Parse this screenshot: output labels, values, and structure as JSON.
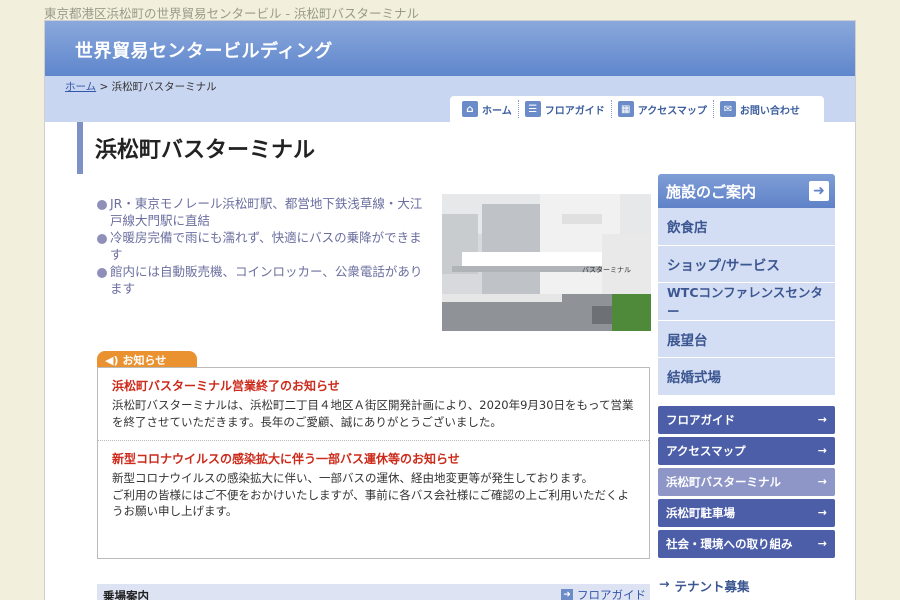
{
  "page_caption": "東京都港区浜松町の世界貿易センタービル - 浜松町バスターミナル",
  "banner_title": "世界貿易センタービルディング",
  "breadcrumb": {
    "home": "ホーム",
    "separator": " > ",
    "current": "浜松町バスターミナル"
  },
  "tabs": [
    {
      "label": "ホーム",
      "icon": "home-icon"
    },
    {
      "label": "フロアガイド",
      "icon": "floor-guide-icon"
    },
    {
      "label": "アクセスマップ",
      "icon": "access-map-icon"
    },
    {
      "label": "お問い合わせ",
      "icon": "mail-icon"
    }
  ],
  "page_title": "浜松町バスターミナル",
  "bullets": [
    "JR・東京モノレール浜松町駅、都営地下鉄浅草線・大江戸線大門駅に直結",
    "冷暖房完備で雨にも濡れず、快適にバスの乗降ができます",
    "館内には自動販売機、コインロッカー、公衆電話があります"
  ],
  "photo": {
    "sign_text": "バスターミナル"
  },
  "notice": {
    "tab_label": "お知らせ",
    "items": [
      {
        "title": "浜松町バスターミナル営業終了のお知らせ",
        "body": "浜松町バスターミナルは、浜松町二丁目４地区Ａ街区開発計画により、2020年9月30日をもって営業を終了させていただきます。長年のご愛顧、誠にありがとうございました。"
      },
      {
        "title": "新型コロナウイルスの感染拡大に伴う一部バス運休等のお知らせ",
        "body": "新型コロナウイルスの感染拡大に伴い、一部バスの運休、経由地変更等が発生しております。",
        "body2": "ご利用の皆様にはご不便をおかけいたしますが、事前に各バス会社様にご確認の上ご利用いただくようお願い申し上げます。"
      }
    ]
  },
  "guide_bar": {
    "left": "乗場案内",
    "right": "フロアガイド"
  },
  "sidebar": {
    "facility_title": "施設のご案内",
    "facilities": [
      "飲食店",
      "ショップ/サービス",
      "WTCコンファレンスセンター",
      "展望台",
      "結婚式場"
    ],
    "links": [
      {
        "label": "フロアガイド",
        "active": false
      },
      {
        "label": "アクセスマップ",
        "active": false
      },
      {
        "label": "浜松町バスターミナル",
        "active": true
      },
      {
        "label": "浜松町駐車場",
        "active": false
      },
      {
        "label": "社会・環境への取り組み",
        "active": false
      }
    ],
    "tenant": "テナント募集"
  },
  "colors": {
    "banner": "#6f93d2",
    "notice_title": "#cc2a1a",
    "notice_tab": "#e9922f",
    "side_link": "#4c5ea8",
    "side_link_active": "#8e96c8"
  }
}
